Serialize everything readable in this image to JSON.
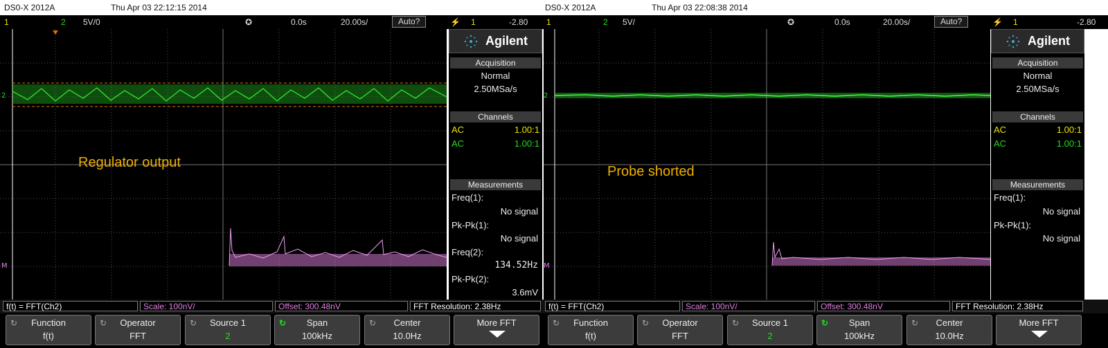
{
  "left": {
    "model": "DS0-X 2012A",
    "datetime": "Thu Apr 03 22:12:15 2014",
    "status": {
      "ch1": "1",
      "ch2": "2",
      "ch2_scale": "5V/0",
      "delay": "0.0s",
      "timebase": "20.00s/",
      "trigger_mode": "Auto?",
      "trig_icon": "⚡",
      "trig_ch": "1",
      "trig_level": "-2.80"
    },
    "annotation": "Regulator output",
    "panel": {
      "brand": "Agilent",
      "acq_header": "Acquisition",
      "acq_mode": "Normal",
      "acq_rate": "2.50MSa/s",
      "ch_header": "Channels",
      "channels": [
        {
          "coupling": "AC",
          "ratio": "1.00:1"
        },
        {
          "coupling": "AC",
          "ratio": "1.00:1"
        }
      ],
      "meas_header": "Measurements",
      "measurements": [
        {
          "label": "Freq(1):",
          "value": "No signal"
        },
        {
          "label": "Pk-Pk(1):",
          "value": "No signal"
        },
        {
          "label": "Freq(2):",
          "value": "134.52Hz"
        },
        {
          "label": "Pk-Pk(2):",
          "value": "3.6mV"
        }
      ]
    },
    "func": {
      "expr": "f(t) = FFT(Ch2)",
      "scale": "Scale: 100nV/",
      "offset": "Offset: 300.48nV",
      "resolution": "FFT Resolution: 2.38Hz"
    },
    "softkeys": [
      {
        "title": "Function",
        "value": "f(t)"
      },
      {
        "title": "Operator",
        "value": "FFT"
      },
      {
        "title": "Source 1",
        "value": "2"
      },
      {
        "title": "Span",
        "value": "100kHz"
      },
      {
        "title": "Center",
        "value": "10.0Hz"
      },
      {
        "title": "More FFT",
        "value": ""
      }
    ]
  },
  "right": {
    "model": "DS0-X 2012A",
    "datetime": "Thu Apr 03 22:08:38 2014",
    "status": {
      "ch1": "1",
      "ch2": "2",
      "ch2_scale": "5V/",
      "delay": "0.0s",
      "timebase": "20.00s/",
      "trigger_mode": "Auto?",
      "trig_icon": "⚡",
      "trig_ch": "1",
      "trig_level": "-2.80"
    },
    "annotation": "Probe shorted",
    "panel": {
      "brand": "Agilent",
      "acq_header": "Acquisition",
      "acq_mode": "Normal",
      "acq_rate": "2.50MSa/s",
      "ch_header": "Channels",
      "channels": [
        {
          "coupling": "AC",
          "ratio": "1.00:1"
        },
        {
          "coupling": "AC",
          "ratio": "1.00:1"
        }
      ],
      "meas_header": "Measurements",
      "measurements": [
        {
          "label": "Freq(1):",
          "value": "No signal"
        },
        {
          "label": "Pk-Pk(1):",
          "value": "No signal"
        }
      ]
    },
    "func": {
      "expr": "f(t) = FFT(Ch2)",
      "scale": "Scale: 100nV/",
      "offset": "Offset: 300.48nV",
      "resolution": "FFT Resolution: 2.38Hz"
    },
    "softkeys": [
      {
        "title": "Function",
        "value": "f(t)"
      },
      {
        "title": "Operator",
        "value": "FFT"
      },
      {
        "title": "Source 1",
        "value": "2"
      },
      {
        "title": "Span",
        "value": "100kHz"
      },
      {
        "title": "Center",
        "value": "10.0Hz"
      },
      {
        "title": "More FFT",
        "value": ""
      }
    ]
  },
  "colors": {
    "ch1": "#f2e600",
    "ch2": "#22dd22",
    "math": "#e080e0",
    "cursor": "#e07000",
    "annotation": "#f0b000",
    "grid": "#555555"
  }
}
